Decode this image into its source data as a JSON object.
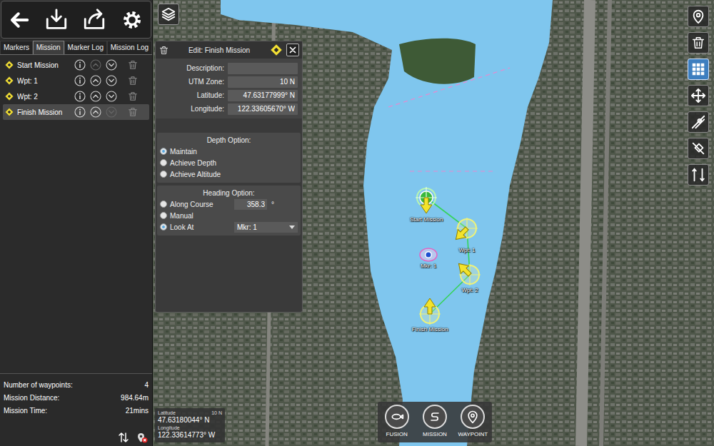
{
  "tabs": [
    {
      "label": "Markers",
      "selected": false
    },
    {
      "label": "Mission",
      "selected": true
    },
    {
      "label": "Marker Log",
      "selected": false
    },
    {
      "label": "Mission Log",
      "selected": false
    }
  ],
  "mission_items": [
    {
      "label": "Start Mission",
      "selected": false,
      "up_disabled": true,
      "down_disabled": false
    },
    {
      "label": "Wpt: 1",
      "selected": false,
      "up_disabled": false,
      "down_disabled": false
    },
    {
      "label": "Wpt: 2",
      "selected": false,
      "up_disabled": false,
      "down_disabled": false
    },
    {
      "label": "Finish Mission",
      "selected": true,
      "up_disabled": false,
      "down_disabled": true
    }
  ],
  "summary": {
    "rows": [
      {
        "label": "Number of waypoints:",
        "value": "4"
      },
      {
        "label": "Mission Distance:",
        "value": "984.64m"
      },
      {
        "label": "Mission Time:",
        "value": "21mins"
      }
    ]
  },
  "edit_panel": {
    "title": "Edit: Finish Mission",
    "fields": [
      {
        "label": "Description:",
        "value": ""
      },
      {
        "label": "UTM Zone:",
        "value": "10 N"
      },
      {
        "label": "Latitude:",
        "value": "47.63177999° N"
      },
      {
        "label": "Longitude:",
        "value": "122.33605670° W"
      }
    ],
    "depth": {
      "title": "Depth Option:",
      "options": [
        {
          "label": "Maintain",
          "selected": true
        },
        {
          "label": "Achieve Depth",
          "selected": false
        },
        {
          "label": "Achieve Altitude",
          "selected": false
        }
      ]
    },
    "heading": {
      "title": "Heading Option:",
      "options": [
        {
          "label": "Along Course",
          "selected": false
        },
        {
          "label": "Manual",
          "selected": false
        },
        {
          "label": "Look At",
          "selected": true
        }
      ],
      "course_value": "358.3",
      "unit": "°",
      "look_at": "Mkr: 1"
    }
  },
  "map_tools": [
    {
      "selected": false
    },
    {
      "selected": false
    },
    {
      "selected": true
    },
    {
      "selected": false
    },
    {
      "selected": false
    },
    {
      "selected": false
    },
    {
      "selected": false
    }
  ],
  "map_pins": [
    {
      "label": "Start Mission",
      "kind": "start",
      "heading": 180
    },
    {
      "label": "Wpt: 1",
      "kind": "waypoint",
      "heading": 225
    },
    {
      "label": "Wpt: 2",
      "kind": "waypoint",
      "heading": 315
    },
    {
      "label": "Finish Mission",
      "kind": "waypoint",
      "heading": 0
    },
    {
      "label": "Mkr: 1",
      "kind": "marker"
    }
  ],
  "mode_buttons": [
    {
      "label": "FUSION"
    },
    {
      "label": "MISSION"
    },
    {
      "label": "WAYPOINT"
    }
  ],
  "cursor": {
    "lat_label": "Latitude",
    "zone": "10 N",
    "latitude": "47.63180044° N",
    "lon_label": "Longitude",
    "longitude": "122.33614773° W"
  }
}
